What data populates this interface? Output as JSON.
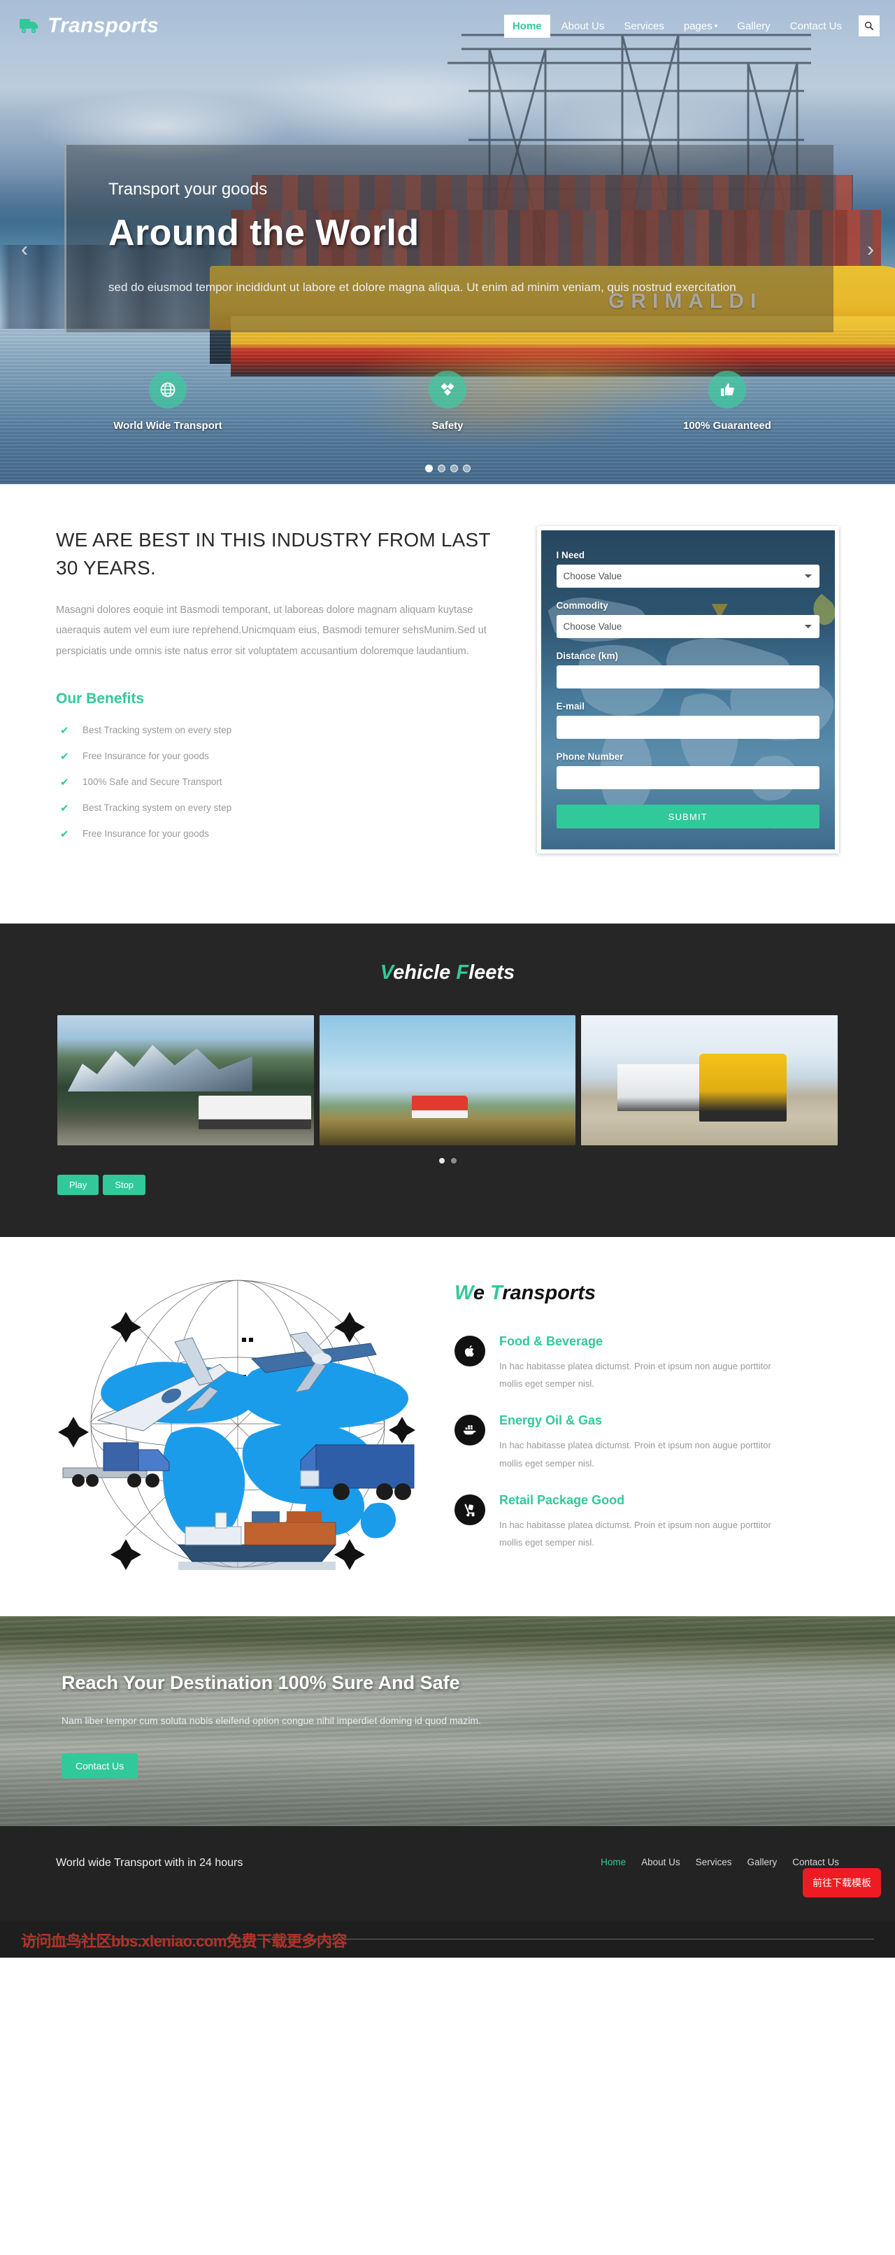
{
  "header": {
    "brand": "Transports",
    "brand_icon": "truck-icon",
    "nav": [
      {
        "label": "Home",
        "active": true
      },
      {
        "label": "About Us",
        "active": false
      },
      {
        "label": "Services",
        "active": false
      },
      {
        "label": "pages",
        "active": false,
        "caret": "▾"
      },
      {
        "label": "Gallery",
        "active": false
      },
      {
        "label": "Contact Us",
        "active": false
      }
    ],
    "search_icon": "search-icon"
  },
  "hero": {
    "kicker": "Transport your goods",
    "title": "Around the World",
    "paragraph": "sed do eiusmod tempor incididunt ut labore et dolore magna aliqua. Ut enim ad minim veniam, quis nostrud exercitation",
    "ship_name": "GRIMALDI",
    "prev_arrow": "‹",
    "next_arrow": "›",
    "features": [
      {
        "label": "World Wide Transport",
        "icon": "globe-icon"
      },
      {
        "label": "Safety",
        "icon": "shield-diamond-icon"
      },
      {
        "label": "100% Guaranteed",
        "icon": "thumbs-up-icon"
      }
    ],
    "slider_dots": 4,
    "slider_active_index": 0
  },
  "best": {
    "heading": "WE ARE BEST IN THIS INDUSTRY FROM LAST 30 YEARS.",
    "paragraph": "Masagni dolores eoquie int Basmodi temporant, ut laboreas dolore magnam aliquam kuytase uaeraquis autem vel eum iure reprehend.Unicmquam eius, Basmodi temurer sehsMunim.Sed ut perspiciatis unde omnis iste natus error sit voluptatem accusantium doloremque laudantium.",
    "benefits_heading": "Our Benefits",
    "benefits": [
      "Best Tracking system on every step",
      "Free Insurance for your goods",
      "100% Safe and Secure Transport",
      "Best Tracking system on every step",
      "Free Insurance for your goods"
    ],
    "check_glyph": "✔"
  },
  "quote_form": {
    "fields": [
      {
        "label": "I Need",
        "type": "select",
        "value": "Choose Value"
      },
      {
        "label": "Commodity",
        "type": "select",
        "value": "Choose Value"
      },
      {
        "label": "Distance (km)",
        "type": "text",
        "value": ""
      },
      {
        "label": "E-mail",
        "type": "text",
        "value": ""
      },
      {
        "label": "Phone Number",
        "type": "text",
        "value": ""
      }
    ],
    "submit_label": "SUBMIT"
  },
  "fleets": {
    "title_accent_1": "V",
    "title_rest_1": "ehicle ",
    "title_accent_2": "F",
    "title_rest_2": "leets",
    "slides": [
      {
        "alt": "white-truck-mountain-road"
      },
      {
        "alt": "red-truck-highway-sky"
      },
      {
        "alt": "yellow-truck-semi-trailer"
      }
    ],
    "dots": 2,
    "dots_active_index": 0,
    "play_label": "Play",
    "stop_label": "Stop"
  },
  "we_transports": {
    "title_accent": "W",
    "title_mid": "e ",
    "title_accent2": "T",
    "title_rest": "ransports",
    "illustration_alt": "world-map-planes-trucks-ship",
    "services": [
      {
        "title": "Food & Beverage",
        "icon": "apple-icon",
        "text": "In hac habitasse platea dictumst. Proin et ipsum non augue porttitor mollis eget semper nisl."
      },
      {
        "title": "Energy Oil & Gas",
        "icon": "ship-container-icon",
        "text": "In hac habitasse platea dictumst. Proin et ipsum non augue porttitor mollis eget semper nisl."
      },
      {
        "title": "Retail Package Good",
        "icon": "hand-truck-icon",
        "text": "In hac habitasse platea dictumst. Proin et ipsum non augue porttitor mollis eget semper nisl."
      }
    ]
  },
  "cta": {
    "heading": "Reach Your Destination 100% Sure And Safe",
    "paragraph": "Nam liber tempor cum soluta nobis eleifend option congue nihil imperdiet doming id quod mazim.",
    "button_label": "Contact Us"
  },
  "footer": {
    "tagline": "World wide Transport with in 24 hours",
    "nav": [
      {
        "label": "Home",
        "active": true
      },
      {
        "label": "About Us",
        "active": false
      },
      {
        "label": "Services",
        "active": false
      },
      {
        "label": "Gallery",
        "active": false
      },
      {
        "label": "Contact Us",
        "active": false
      }
    ],
    "download_badge": "前往下载模板",
    "watermark": "访问血鸟社区bbs.xleniao.com免费下载更多内容"
  },
  "colors": {
    "accent": "#31c99a",
    "dark": "#262626",
    "muted": "#9a9a9a",
    "badge_red": "#ee1b23"
  }
}
